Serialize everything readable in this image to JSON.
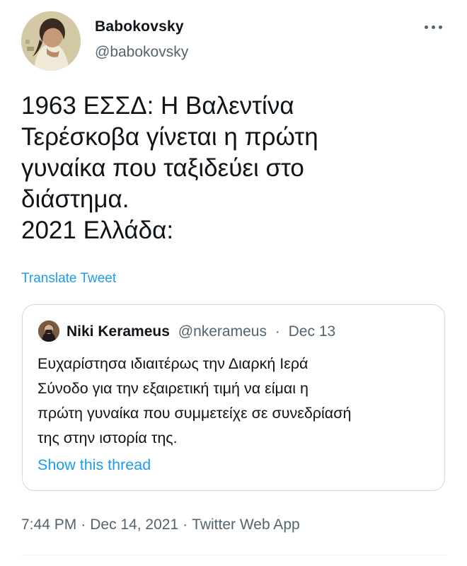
{
  "author": {
    "display_name": "Babokovsky",
    "handle": "@babokovsky",
    "avatar_icon": "profile-photo"
  },
  "more_icon": "more-options-icon",
  "tweet": {
    "lines": [
      "1963 ΕΣΣΔ: Η Βαλεντίνα",
      "Τερέσκοβα γίνεται η πρώτη",
      "γυναίκα που ταξιδεύει στο",
      "διάστημα.",
      "2021 Ελλάδα:"
    ]
  },
  "translate_label": "Translate Tweet",
  "quote": {
    "display_name": "Niki Kerameus",
    "handle": "@nkerameus",
    "separator": "·",
    "date": "Dec 13",
    "lines": [
      "Ευχαρίστησα ιδιαιτέρως την Διαρκή Ιερά",
      "Σύνοδο για την εξαιρετική τιμή να είμαι η",
      "πρώτη γυναίκα που συμμετείχε σε συνεδρίασή",
      "της στην ιστορία της."
    ],
    "show_thread_label": "Show this thread"
  },
  "meta": {
    "time": "7:44 PM",
    "separator": "·",
    "date": "Dec 14, 2021",
    "source": "Twitter Web App"
  },
  "colors": {
    "text": "#0f1419",
    "secondary": "#536471",
    "link": "#1d9bf0",
    "border": "#cfd9de"
  }
}
